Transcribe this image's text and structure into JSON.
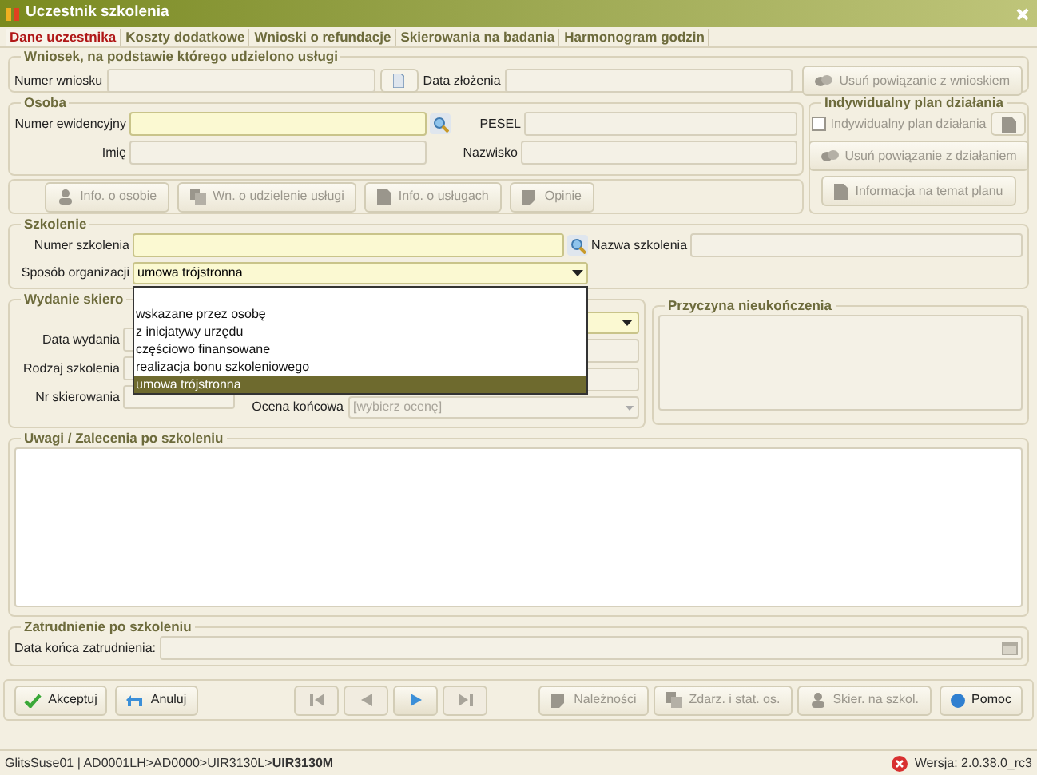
{
  "window": {
    "title": "Uczestnik szkolenia"
  },
  "tabs": [
    {
      "label": "Dane uczestnika",
      "selected": true
    },
    {
      "label": "Koszty dodatkowe",
      "selected": false
    },
    {
      "label": "Wnioski o refundacje",
      "selected": false
    },
    {
      "label": "Skierowania na badania",
      "selected": false
    },
    {
      "label": "Harmonogram godzin",
      "selected": false
    }
  ],
  "request": {
    "title": "Wniosek, na podstawie którego udzielono usługi",
    "number_label": "Numer wniosku",
    "date_label": "Data złożenia",
    "unlink_button": {
      "label": "Usuń powiązanie z wnioskiem",
      "disabled": true
    }
  },
  "person": {
    "title": "Osoba",
    "id_label": "Numer ewidencyjny",
    "pesel_label": "PESEL",
    "first_name_label": "Imię",
    "last_name_label": "Nazwisko"
  },
  "person_buttons": [
    {
      "label": "Info. o osobie",
      "kind": "person",
      "disabled": true
    },
    {
      "label": "Wn. o udzielenie usługi",
      "kind": "copy",
      "disabled": true
    },
    {
      "label": "Info. o usługach",
      "kind": "doc",
      "disabled": true
    },
    {
      "label": "Opinie",
      "kind": "notes",
      "disabled": true
    }
  ],
  "plan": {
    "title": "Indywidualny plan działania",
    "checkbox": {
      "label": "Indywidualny plan działania",
      "checked": false
    },
    "buttons": [
      {
        "label": "Usuń powiązanie z działaniem",
        "kind": "unlink",
        "disabled": true
      },
      {
        "label": "Informacja na temat planu",
        "kind": "doc",
        "disabled": true
      }
    ]
  },
  "training": {
    "title": "Szkolenie",
    "number_label": "Numer szkolenia",
    "name_label": "Nazwa szkolenia",
    "org_label": "Sposób organizacji",
    "org_value": "umowa trójstronna",
    "org_options": [
      {
        "label": "wskazane przez osobę",
        "selected": false
      },
      {
        "label": "z inicjatywy urzędu",
        "selected": false
      },
      {
        "label": "częściowo finansowane",
        "selected": false
      },
      {
        "label": "realizacja bonu szkoleniowego",
        "selected": false
      },
      {
        "label": "umowa trójstronna",
        "selected": true
      }
    ]
  },
  "referral": {
    "title": "Wydanie skiero",
    "date_label": "Data wydania",
    "type_label": "Rodzaj szkolenia",
    "number_label": "Nr skierowania",
    "grade_label": "Ocena końcowa",
    "grade_value": "[wybierz ocenę]"
  },
  "reason": {
    "title": "Przyczyna nieukończenia"
  },
  "notes": {
    "title": "Uwagi / Zalecenia po szkoleniu"
  },
  "employment": {
    "title": "Zatrudnienie po szkoleniu",
    "end_date_label": "Data końca zatrudnienia:"
  },
  "footer": {
    "accept": {
      "label": "Akceptuj",
      "disabled": false
    },
    "cancel": {
      "label": "Anuluj",
      "disabled": false
    },
    "nav": [
      {
        "kind": "first",
        "disabled": true
      },
      {
        "kind": "prev",
        "disabled": true
      },
      {
        "kind": "next",
        "disabled": false
      },
      {
        "kind": "last",
        "disabled": true
      }
    ],
    "actions": [
      {
        "label": "Należności",
        "kind": "notes",
        "disabled": true
      },
      {
        "label": "Zdarz. i stat. os.",
        "kind": "copy",
        "disabled": true
      },
      {
        "label": "Skier. na szkol.",
        "kind": "person",
        "disabled": true
      }
    ],
    "help": {
      "label": "Pomoc",
      "disabled": false
    }
  },
  "status_bar": {
    "path": "GlitsSuse01 | AD0001LH>AD0000>UIR3130L>**UIR3130M**",
    "version": "Wersja: 2.0.38.0_rc3"
  }
}
